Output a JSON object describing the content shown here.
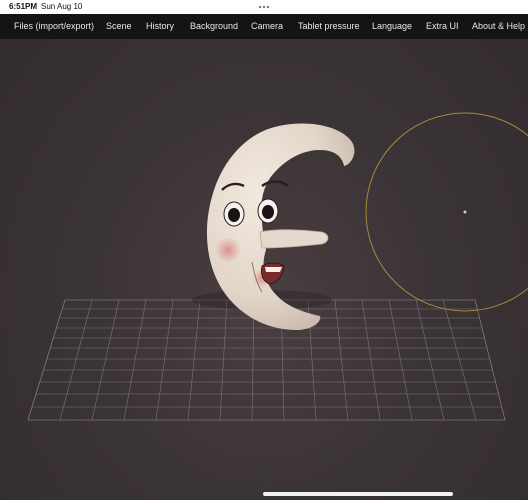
{
  "status_bar": {
    "time": "6:51PM",
    "date": "Sun Aug 10",
    "multitask_icon": "three-dots-icon"
  },
  "menu": {
    "items": [
      {
        "label": "Files (import/export)"
      },
      {
        "label": "Scene"
      },
      {
        "label": "History"
      },
      {
        "label": "Background"
      },
      {
        "label": "Camera"
      },
      {
        "label": "Tablet pressure"
      },
      {
        "label": "Language"
      },
      {
        "label": "Extra UI"
      },
      {
        "label": "About & Help"
      }
    ]
  },
  "scene": {
    "subject": "crescent-moon-face-model",
    "grid": true,
    "brush_cursor_color": "#a8893a"
  },
  "colors": {
    "menu_bg": "#141414",
    "viewport_bg": "#3a3335",
    "model": "#e6dcd2",
    "grid_line": "#8a8587"
  }
}
